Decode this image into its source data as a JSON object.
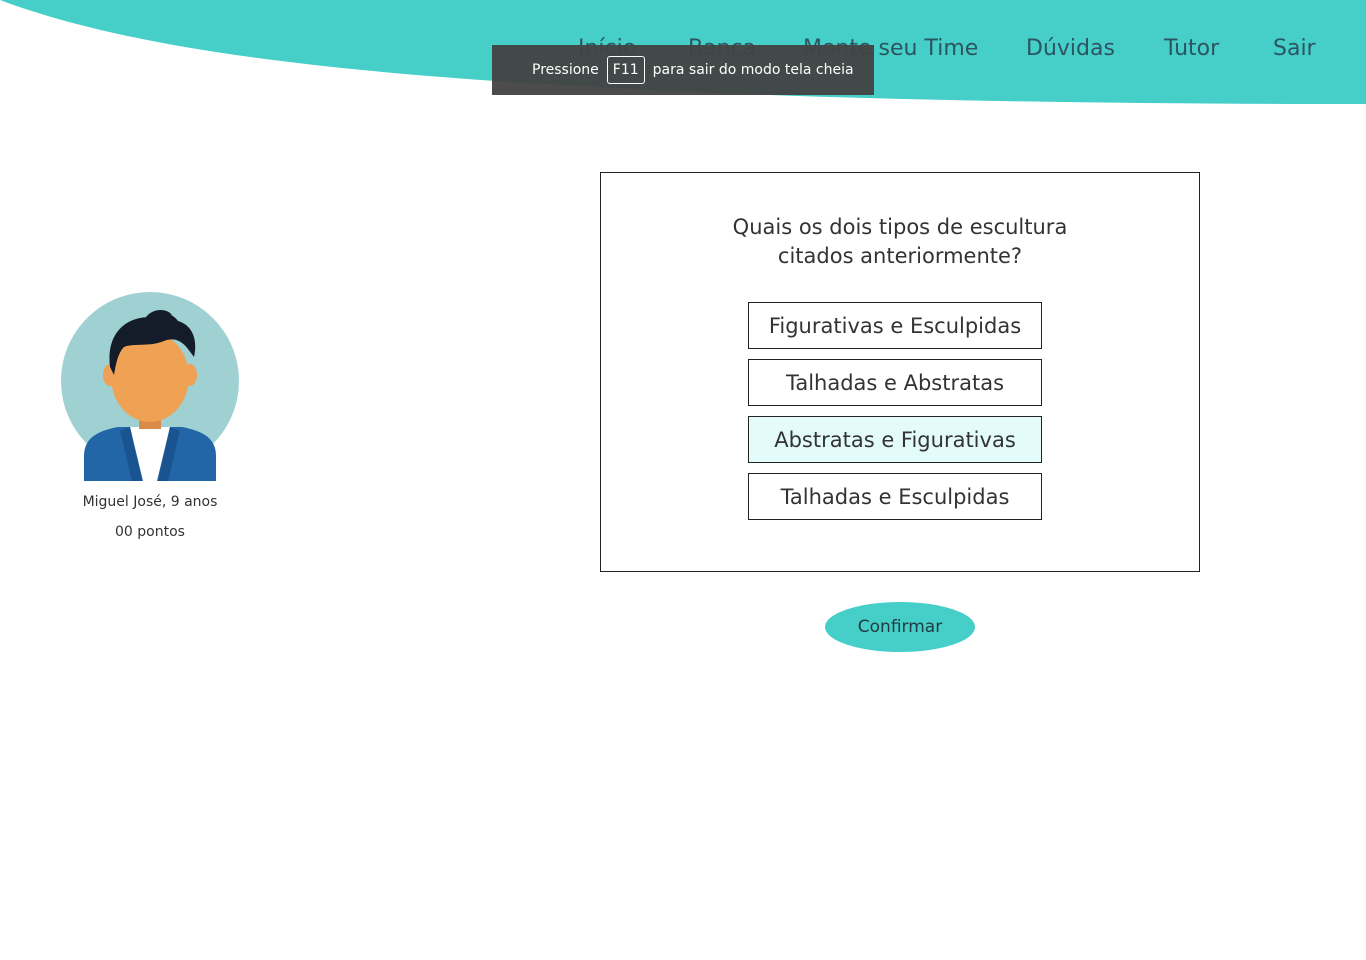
{
  "header": {
    "accent_color": "#46cec8",
    "nav": [
      {
        "label": "Início"
      },
      {
        "label": "Banca"
      },
      {
        "label": "Monte seu Time"
      },
      {
        "label": "Dúvidas"
      },
      {
        "label": "Tutor"
      },
      {
        "label": "Sair"
      }
    ]
  },
  "fullscreen_notice": {
    "before": "Pressione",
    "key": "F11",
    "after": "para sair do modo tela cheia"
  },
  "profile": {
    "name": "Miguel José, 9 anos",
    "points": "00 pontos",
    "avatar_icon": "boy-avatar-icon"
  },
  "quiz": {
    "question_line1": "Quais os dois tipos de escultura",
    "question_line2": "citados anteriormente?",
    "options": [
      {
        "label": "Figurativas e Esculpidas",
        "selected": false
      },
      {
        "label": "Talhadas e Abstratas",
        "selected": false
      },
      {
        "label": "Abstratas e Figurativas",
        "selected": true
      },
      {
        "label": "Talhadas e Esculpidas",
        "selected": false
      }
    ],
    "confirm_label": "Confirmar"
  }
}
